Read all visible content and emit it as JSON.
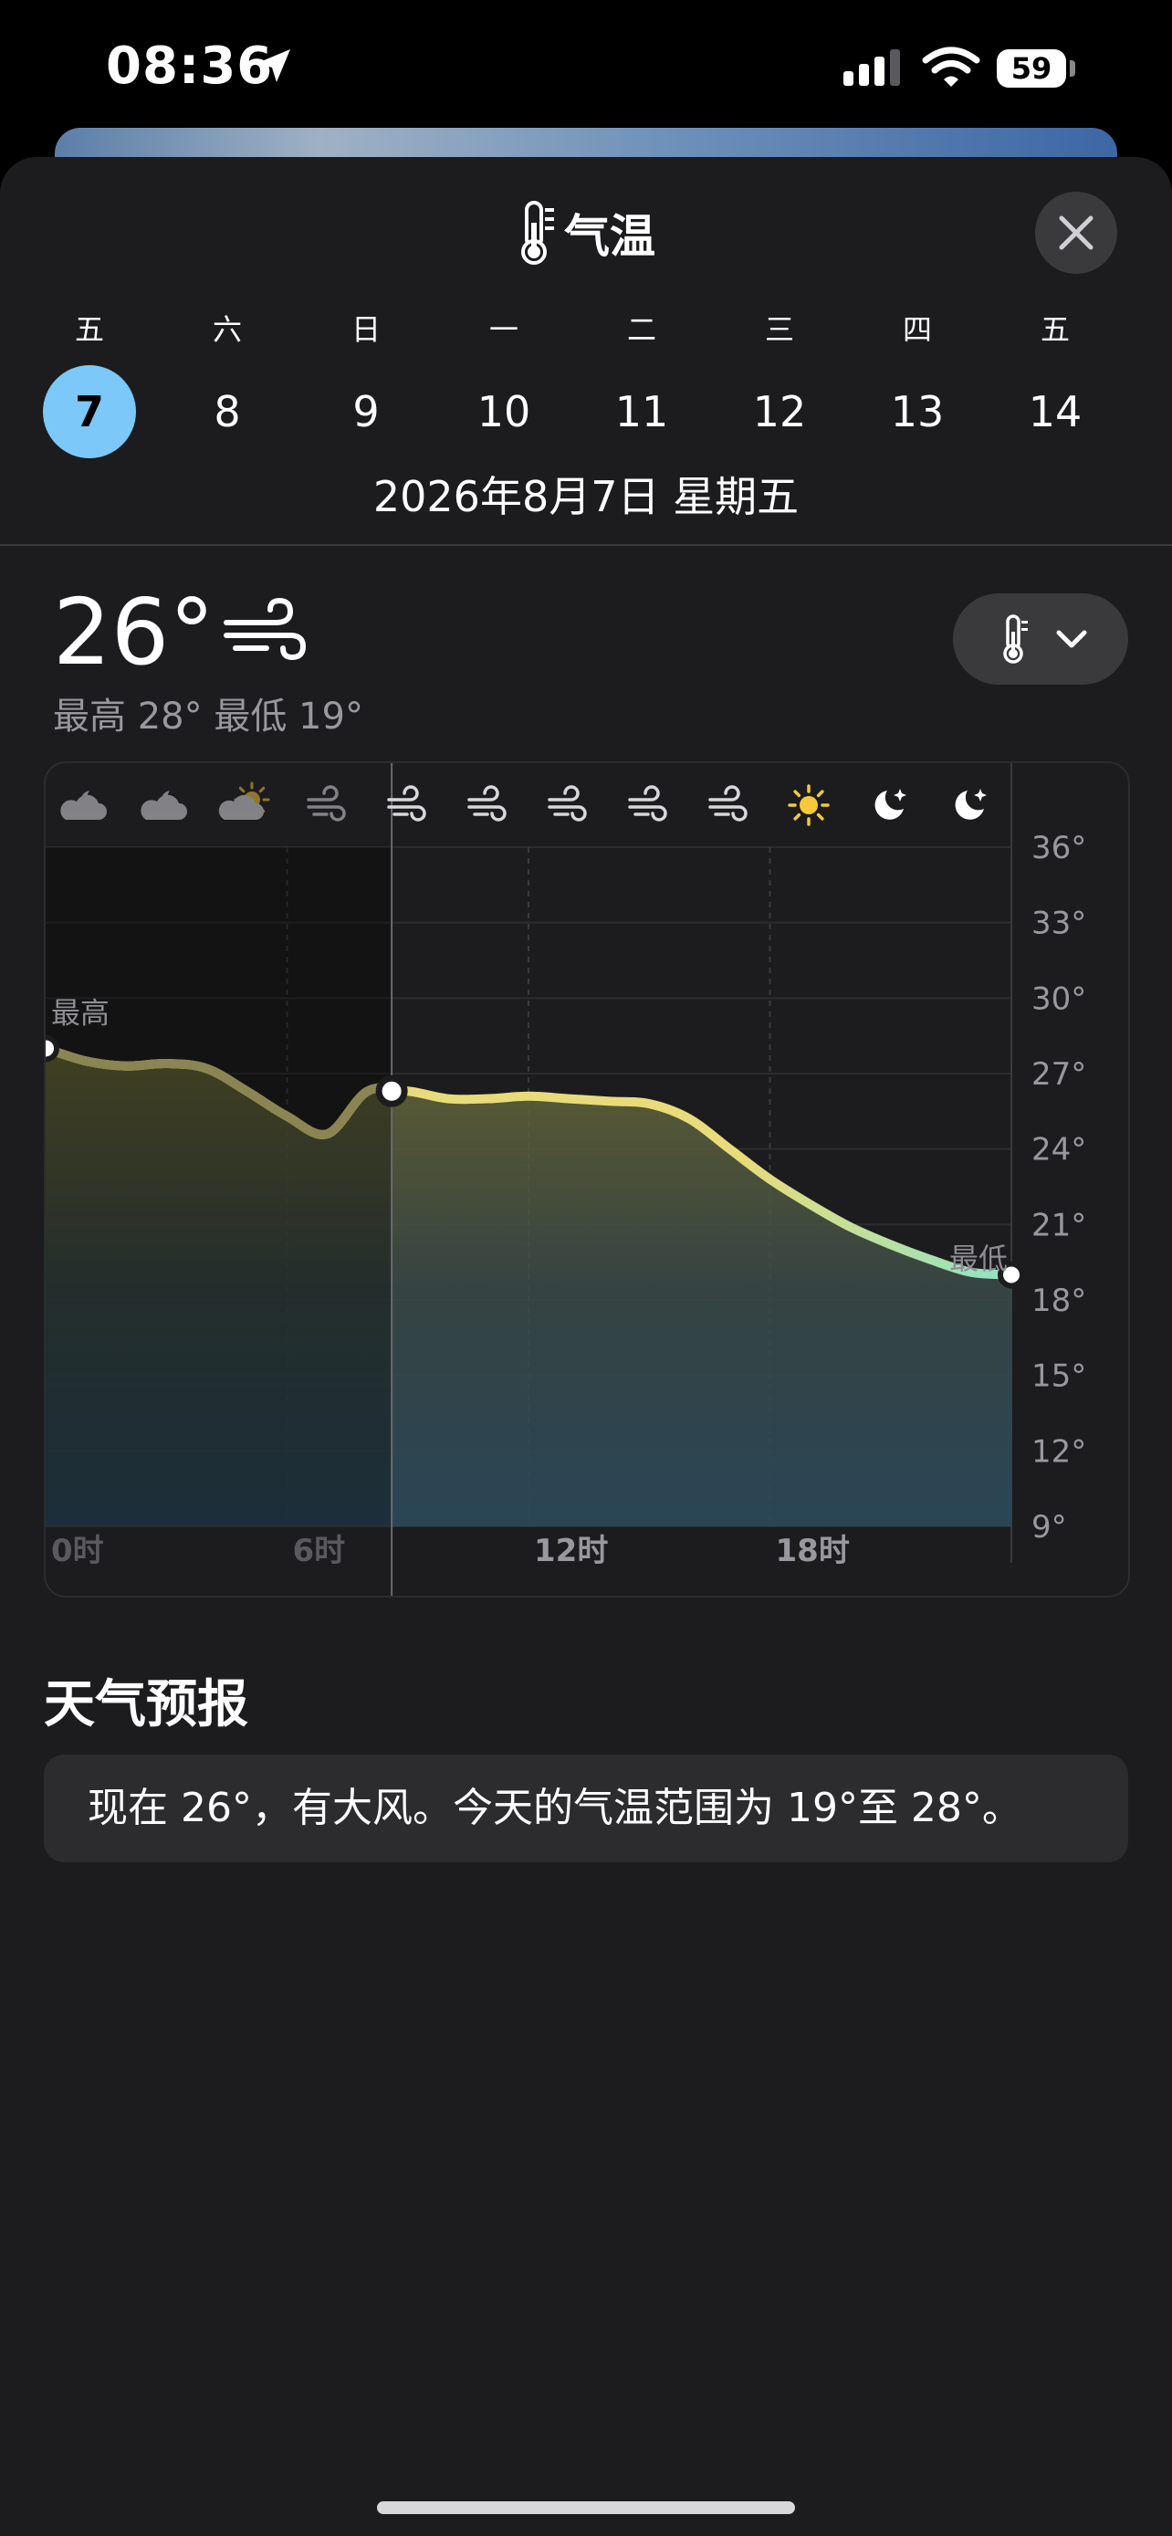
{
  "status_bar": {
    "time": "08:36",
    "battery": "59"
  },
  "header": {
    "title": "气温"
  },
  "days": [
    {
      "weekday": "五",
      "day": "7",
      "selected": true
    },
    {
      "weekday": "六",
      "day": "8"
    },
    {
      "weekday": "日",
      "day": "9"
    },
    {
      "weekday": "一",
      "day": "10"
    },
    {
      "weekday": "二",
      "day": "11"
    },
    {
      "weekday": "三",
      "day": "12"
    },
    {
      "weekday": "四",
      "day": "13"
    },
    {
      "weekday": "五",
      "day": "14"
    }
  ],
  "date_label": "2026年8月7日 星期五",
  "current": {
    "temp": "26°",
    "hilo": "最高 28° 最低 19°"
  },
  "colors": {
    "selected_day": "#7cc8f8",
    "sheet_bg": "#1c1c1e",
    "curve_warm": "#e8dc7a",
    "curve_cool": "#8fe3c6"
  },
  "chart_data": {
    "type": "area",
    "x": [
      0,
      1,
      2,
      3,
      4,
      5,
      6,
      7,
      8,
      9,
      10,
      11,
      12,
      13,
      14,
      15,
      16,
      17,
      18,
      19,
      20,
      21,
      22,
      23,
      24
    ],
    "values": [
      28,
      27.5,
      27.3,
      27.4,
      27.2,
      26.3,
      25.3,
      24.6,
      26.3,
      26.3,
      26.0,
      26.0,
      26.1,
      26.0,
      25.9,
      25.8,
      25.2,
      24.0,
      22.8,
      21.8,
      20.9,
      20.2,
      19.6,
      19.1,
      19.0
    ],
    "current_hour": 8.6,
    "ylim": [
      9,
      36
    ],
    "y_ticks": [
      "36°",
      "33°",
      "30°",
      "27°",
      "24°",
      "21°",
      "18°",
      "15°",
      "12°",
      "9°"
    ],
    "x_ticks": [
      "0时",
      "6时",
      "12时",
      "18时"
    ],
    "annotations": {
      "high": "最高",
      "low": "最低"
    },
    "weather_icons": [
      "moon-cloud-icon",
      "moon-cloud-icon",
      "sun-cloud-icon",
      "wind-icon",
      "wind-icon",
      "wind-icon",
      "wind-icon",
      "wind-icon",
      "wind-icon",
      "sun-icon",
      "moon-stars-icon",
      "moon-stars-icon"
    ],
    "grid": true
  },
  "forecast": {
    "title": "天气预报",
    "text": "现在 26°，有大风。今天的气温范围为 19°至 28°。"
  }
}
